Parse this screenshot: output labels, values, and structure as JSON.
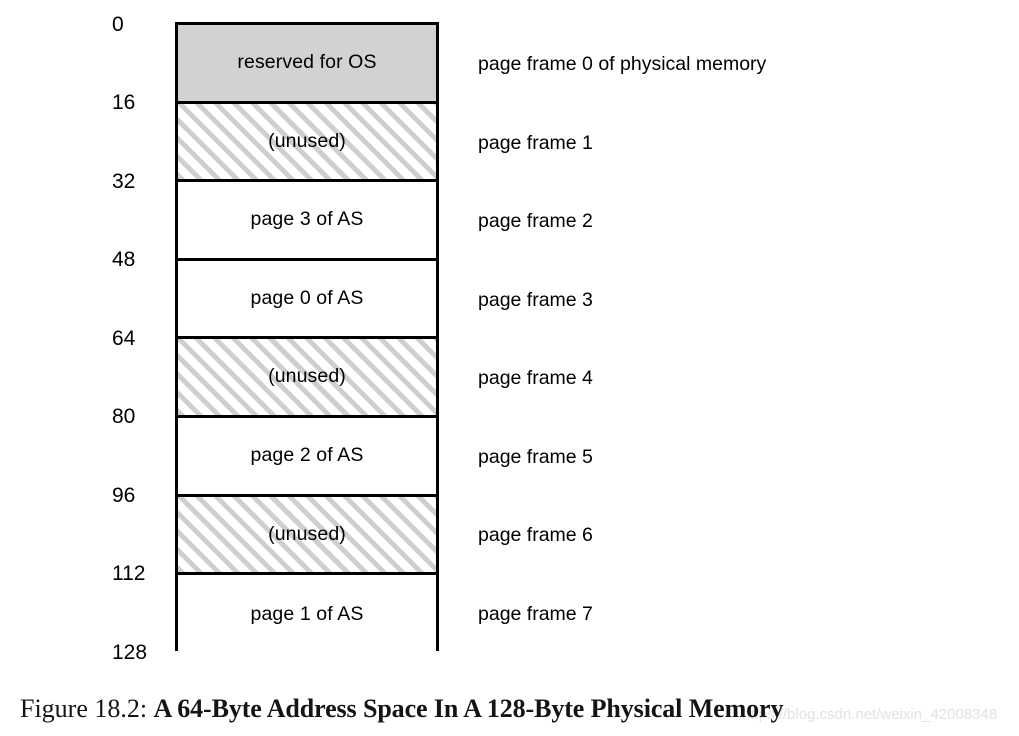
{
  "figure": {
    "caption_prefix": "Figure 18.2:",
    "caption_title": "A 64-Byte Address Space In A 128-Byte Physical Memory",
    "watermark": "https://blog.csdn.net/weixin_42008348"
  },
  "diagram": {
    "type": "memory-layout",
    "total_bytes": 128,
    "frame_size_bytes": 16,
    "frame_count": 8,
    "colors": {
      "reserved_fill": "#d2d2d2",
      "unused_hatch": "#cfcfcf",
      "used_fill": "#ffffff",
      "border": "#000000"
    },
    "offsets": [
      "0",
      "16",
      "32",
      "48",
      "64",
      "80",
      "96",
      "112",
      "128"
    ],
    "frames": [
      {
        "index": 0,
        "offset_start": "0",
        "offset_end": "16",
        "content": "reserved for OS",
        "fill": "gray",
        "side_label": "page frame 0 of physical memory"
      },
      {
        "index": 1,
        "offset_start": "16",
        "offset_end": "32",
        "content": "(unused)",
        "fill": "hatch",
        "side_label": "page frame 1"
      },
      {
        "index": 2,
        "offset_start": "32",
        "offset_end": "48",
        "content": "page 3 of AS",
        "fill": "white",
        "side_label": "page frame 2"
      },
      {
        "index": 3,
        "offset_start": "48",
        "offset_end": "64",
        "content": "page 0 of AS",
        "fill": "white",
        "side_label": "page frame 3"
      },
      {
        "index": 4,
        "offset_start": "64",
        "offset_end": "80",
        "content": "(unused)",
        "fill": "hatch",
        "side_label": "page frame 4"
      },
      {
        "index": 5,
        "offset_start": "80",
        "offset_end": "96",
        "content": "page 2 of AS",
        "fill": "white",
        "side_label": "page frame 5"
      },
      {
        "index": 6,
        "offset_start": "96",
        "offset_end": "112",
        "content": "(unused)",
        "fill": "hatch",
        "side_label": "page frame 6"
      },
      {
        "index": 7,
        "offset_start": "112",
        "offset_end": "128",
        "content": "page 1 of AS",
        "fill": "white",
        "side_label": "page frame 7"
      }
    ]
  }
}
